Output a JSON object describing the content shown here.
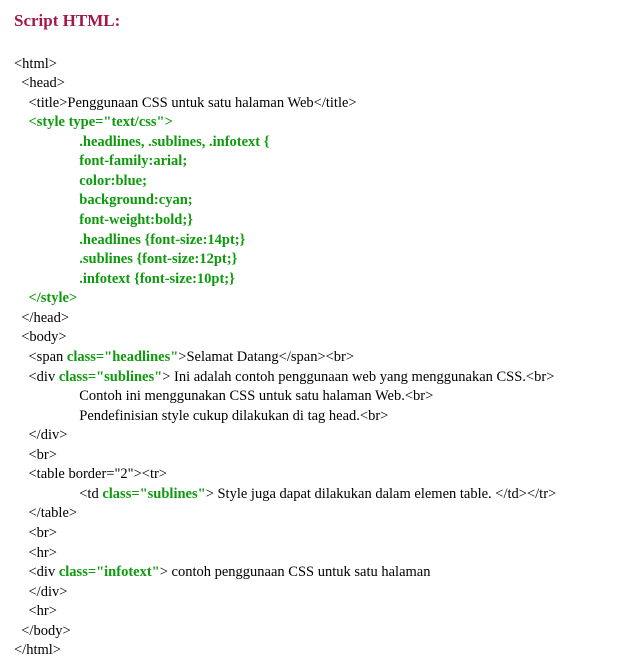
{
  "heading": "Script HTML:",
  "l01": "<html>",
  "l02": "  <head>",
  "l03": "    <title>Penggunaan CSS untuk satu halaman Web</title>",
  "l04a": "    ",
  "l04b": "<style type=\"text/css\">",
  "l05": "                  .headlines, .sublines, .infotext {",
  "l06": "                  font-family:arial;",
  "l07": "                  color:blue;",
  "l08": "                  background:cyan;",
  "l09": "                  font-weight:bold;}",
  "l10": "                  .headlines {font-size:14pt;}",
  "l11": "                  .sublines {font-size:12pt;}",
  "l12": "                  .infotext {font-size:10pt;}",
  "l13a": "    ",
  "l13b": "</style>",
  "l14": "  </head>",
  "l15": "  <body>",
  "l16a": "    <span ",
  "l16b": "class=\"headlines\"",
  "l16c": ">Selamat Datang</span><br>",
  "l17a": "    <div ",
  "l17b": "class=\"sublines\"",
  "l17c": "> Ini adalah contoh penggunaan web yang menggunakan CSS.<br>",
  "l18": "                  Contoh ini menggunakan CSS untuk satu halaman Web.<br>",
  "l19": "                  Pendefinisian style cukup dilakukan di tag head.<br>",
  "l20": "    </div>",
  "l21": "    <br>",
  "l22": "    <table border=\"2\"><tr>",
  "l23a": "                  <td ",
  "l23b": "class=\"sublines\"",
  "l23c": "> Style juga dapat dilakukan dalam elemen table. </td></tr>",
  "l24": "    </table>",
  "l25": "    <br>",
  "l26": "    <hr>",
  "l27a": "    <div ",
  "l27b": "class=\"infotext\"",
  "l27c": "> contoh penggunaan CSS untuk satu halaman",
  "l28": "    </div>",
  "l29": "    <hr>",
  "l30": "  </body>",
  "l31": "</html>"
}
